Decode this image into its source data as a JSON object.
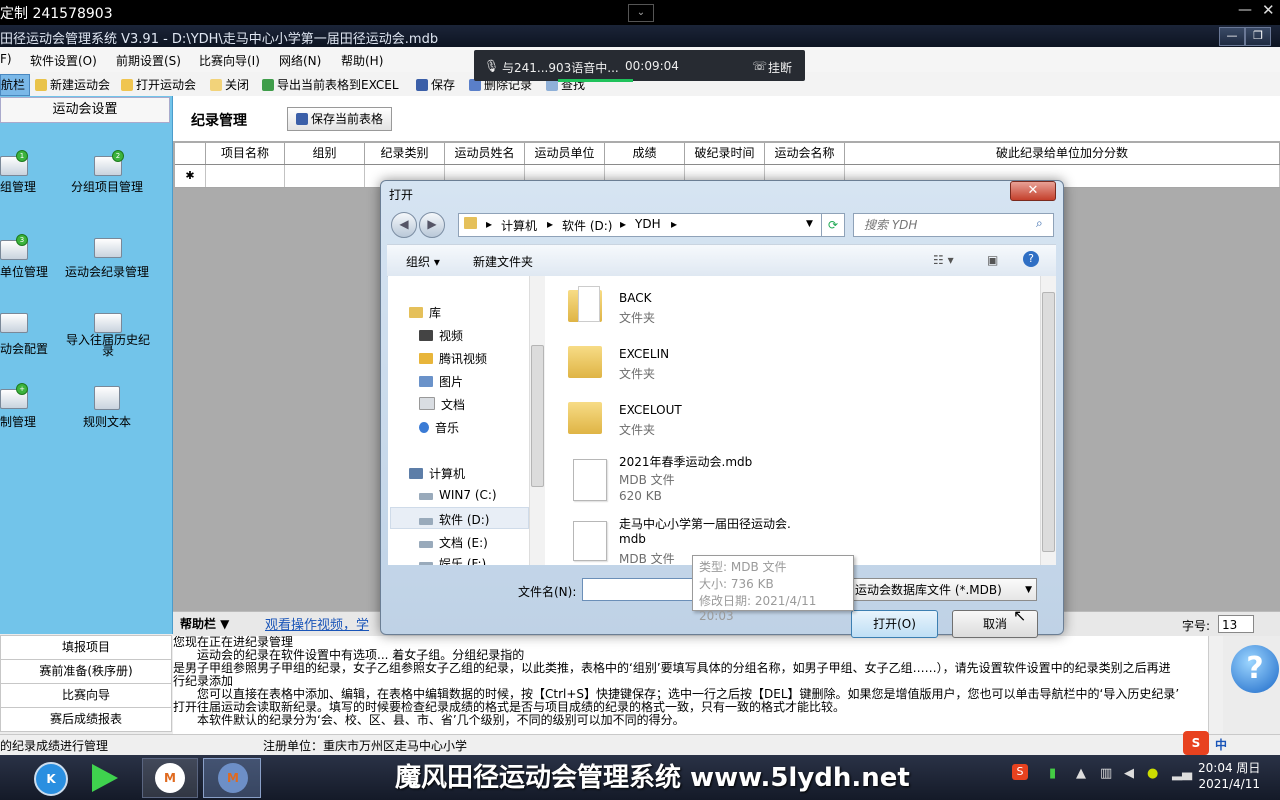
{
  "recording": {
    "title": "定制 241578903",
    "min": "—",
    "close": "✕",
    "chev": "⌄"
  },
  "app": {
    "title": "田径运动会管理系统 V3.91  - D:\\YDH\\走马中心小学第一届田径运动会.mdb",
    "btn_min": "—",
    "btn_max": "❐"
  },
  "menu": [
    "F)",
    "软件设置(O)",
    "前期设置(S)",
    "比赛向导(I)",
    "网络(N)",
    "帮助(H)"
  ],
  "toolbar": {
    "nav_tab": "航栏",
    "new_meet": "新建运动会",
    "open_meet": "打开运动会",
    "close": "关闭",
    "export_excel": "导出当前表格到EXCEL",
    "save": "保存",
    "delete_record": "删除记录",
    "find": "查找"
  },
  "voice_call": {
    "label": "与241...903语音中...",
    "timer": "00:09:04",
    "hangup": "挂断"
  },
  "left_panel": {
    "header": "运动会设置",
    "items": [
      {
        "label": "组管理",
        "badge": "1"
      },
      {
        "label": "分组项目管理",
        "badge": "2"
      },
      {
        "label": "单位管理",
        "badge": "3"
      },
      {
        "label": "运动会纪录管理",
        "badge": ""
      },
      {
        "label": "动会配置",
        "badge": ""
      },
      {
        "label": "导入往届历史纪录",
        "badge": ""
      },
      {
        "label": "制管理",
        "badge": "+"
      },
      {
        "label": "规则文本",
        "badge": ""
      }
    ],
    "bottom": [
      "填报项目",
      "赛前准备(秩序册)",
      "比赛向导",
      "赛后成绩报表"
    ]
  },
  "main": {
    "title": "纪录管理",
    "save_table": "保存当前表格",
    "columns": [
      "项目名称",
      "组别",
      "纪录类别",
      "运动员姓名",
      "运动员单位",
      "成绩",
      "破纪录时间",
      "运动会名称",
      "破此纪录给单位加分分数"
    ],
    "new_row_marker": "✱"
  },
  "help": {
    "title": "帮助栏 ▼",
    "link": "观看操作视频，学",
    "font_label": "字号:",
    "font_size": "13",
    "lines": [
      "您现在正在进纪录管理",
      "　　运动会的纪录在软件设置中有选项...                                                                                                                      着女子组。分组纪录指的",
      "是男子甲组参照男子甲组的纪录，女子乙组参照女子乙组的纪录，以此类推，表格中的‘组别’要填写具体的分组名称，如男子甲组、女子乙组……），请先设置软件设置中的纪录类别之后再进",
      "行纪录添加",
      "　　您可以直接在表格中添加、编辑，在表格中编辑数据的时候，按【Ctrl+S】快捷键保存；选中一行之后按【DEL】键删除。如果您是增值版用户，您也可以单击导航栏中的‘导入历史纪录’",
      "打开往届运动会读取新纪录。填写的时候要检查纪录成绩的格式是否与项目成绩的纪录的格式一致，只有一致的格式才能比较。",
      "　　本软件默认的纪录分为‘会、校、区、县、市、省’几个级别，不同的级别可以加不同的得分。"
    ]
  },
  "status": {
    "left": "的纪录成绩进行管理",
    "unit": "注册单位：重庆市万州区走马中心小学"
  },
  "taskbar": {
    "caption": "魔风田径运动会管理系统  www.5lydh.net",
    "time": "20:04 周日",
    "date": "2021/4/11",
    "ime": "中"
  },
  "dialog": {
    "title": "打开",
    "close": "✕",
    "path": [
      "计算机",
      "软件 (D:)",
      "YDH"
    ],
    "search_placeholder": "搜索 YDH",
    "organize": "组织 ▾",
    "new_folder": "新建文件夹",
    "tree": {
      "library": "库",
      "video": "视频",
      "tencent_video": "腾讯视频",
      "pictures": "图片",
      "documents": "文档",
      "music": "音乐",
      "computer": "计算机",
      "drive_c": "WIN7 (C:)",
      "drive_d": "软件 (D:)",
      "drive_e": "文档 (E:)",
      "drive_f": "娱乐 (F:)"
    },
    "files": [
      {
        "name": "BACK",
        "type": "文件夹",
        "size": ""
      },
      {
        "name": "EXCELIN",
        "type": "文件夹",
        "size": ""
      },
      {
        "name": "EXCELOUT",
        "type": "文件夹",
        "size": ""
      },
      {
        "name": "2021年春季运动会.mdb",
        "type": "MDB 文件",
        "size": "620 KB"
      },
      {
        "name": "走马中心小学第一届田径运动会.",
        "name2": "mdb",
        "type": "MDB 文件",
        "size": ""
      }
    ],
    "tooltip": {
      "type": "类型: MDB 文件",
      "size": "大小: 736 KB",
      "modified": "修改日期: 2021/4/11 20:03"
    },
    "filename_label": "文件名(N):",
    "filename_value": "",
    "filetype": "运动会数据库文件 (*.MDB)",
    "open_button": "打开(O)",
    "cancel_button": "取消"
  }
}
